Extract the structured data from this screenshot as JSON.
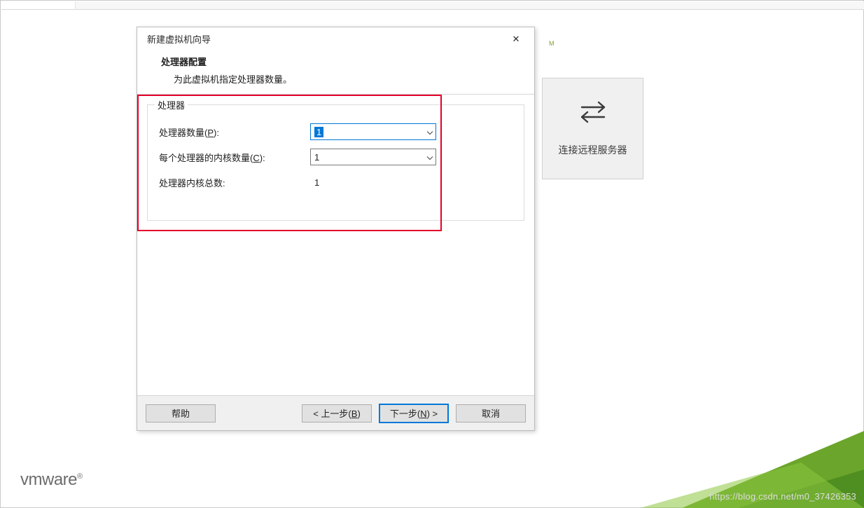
{
  "trademark": "M",
  "card": {
    "label": "连接远程服务器"
  },
  "dialog": {
    "title": "新建虚拟机向导",
    "close": "✕",
    "heading": "处理器配置",
    "subheading": "为此虚拟机指定处理器数量。",
    "group_legend": "处理器",
    "labels": {
      "processors_prefix": "处理器数量(",
      "processors_key": "P",
      "processors_suffix": "):",
      "cores_prefix": "每个处理器的内核数量(",
      "cores_key": "C",
      "cores_suffix": "):",
      "total": "处理器内核总数:"
    },
    "values": {
      "processors": "1",
      "cores": "1",
      "total": "1"
    },
    "buttons": {
      "help": "帮助",
      "back_prefix": "< 上一步(",
      "back_key": "B",
      "back_suffix": ")",
      "next_prefix": "下一步(",
      "next_key": "N",
      "next_suffix": ") >",
      "cancel": "取消"
    }
  },
  "logo_text": "vmware",
  "logo_reg": "®",
  "watermark": "https://blog.csdn.net/m0_37426353"
}
